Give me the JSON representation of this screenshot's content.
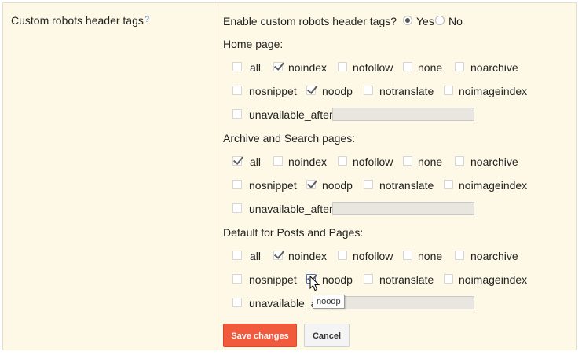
{
  "setting_label": "Custom robots header tags",
  "help_label": "?",
  "enable": {
    "question": "Enable custom robots header tags?",
    "yes": "Yes",
    "no": "No",
    "selected": "yes"
  },
  "sections": [
    {
      "title": "Home page:",
      "tags": {
        "all": false,
        "noindex": true,
        "nofollow": false,
        "none": false,
        "noarchive": false,
        "nosnippet": false,
        "noodp": true,
        "notranslate": false,
        "noimageindex": false,
        "unavailable_after": false
      },
      "unavailable_after_value": ""
    },
    {
      "title": "Archive and Search pages:",
      "tags": {
        "all": true,
        "noindex": false,
        "nofollow": false,
        "none": false,
        "noarchive": false,
        "nosnippet": false,
        "noodp": true,
        "notranslate": false,
        "noimageindex": false,
        "unavailable_after": false
      },
      "unavailable_after_value": ""
    },
    {
      "title": "Default for Posts and Pages:",
      "tags": {
        "all": false,
        "noindex": true,
        "nofollow": false,
        "none": false,
        "noarchive": false,
        "nosnippet": false,
        "noodp": true,
        "notranslate": false,
        "noimageindex": false,
        "unavailable_after": false
      },
      "unavailable_after_value": ""
    }
  ],
  "tag_labels": {
    "all": "all",
    "noindex": "noindex",
    "nofollow": "nofollow",
    "none": "none",
    "noarchive": "noarchive",
    "nosnippet": "nosnippet",
    "noodp": "noodp",
    "notranslate": "notranslate",
    "noimageindex": "noimageindex",
    "unavailable_after": "unavailable_after:"
  },
  "tooltip": "noodp",
  "buttons": {
    "save": "Save changes",
    "cancel": "Cancel"
  },
  "colors": {
    "panel_bg": "#fef9e6",
    "save_bg": "#f15a3c",
    "help": "#5a8fd6",
    "focus": "#4d6fc0"
  }
}
